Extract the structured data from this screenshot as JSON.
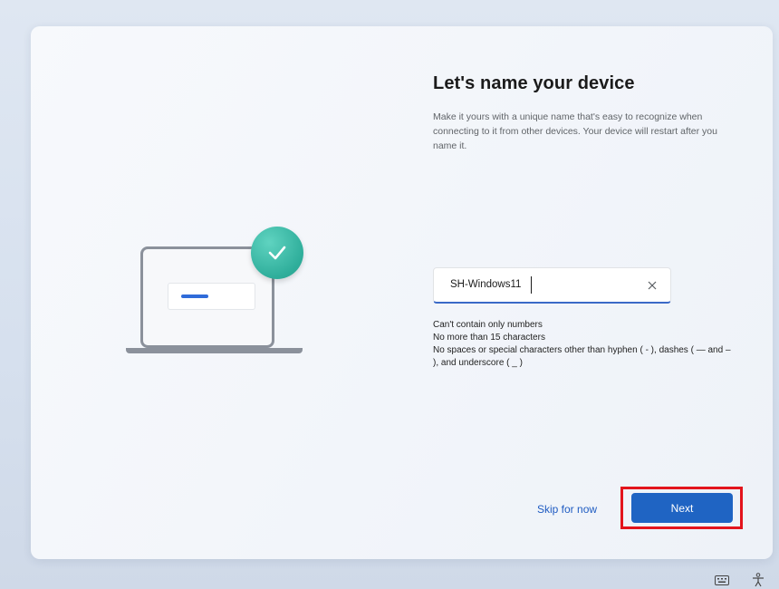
{
  "page": {
    "title": "Let's name your device",
    "description": "Make it yours with a unique name that's easy to recognize when connecting to it from other devices. Your device will restart after you name it."
  },
  "device_name_input": {
    "value": "SH-Windows11",
    "clear_icon": "close-icon"
  },
  "rules": [
    "Can't contain only numbers",
    "No more than 15 characters",
    "No spaces or special characters other than hyphen ( - ), dashes ( — and – ), and underscore ( _ )"
  ],
  "actions": {
    "skip_label": "Skip for now",
    "next_label": "Next"
  },
  "colors": {
    "accent": "#1f64c3",
    "check": "#2fae9b",
    "highlight": "#e3141c"
  },
  "taskbar": {
    "icons": [
      "keyboard-icon",
      "accessibility-icon"
    ]
  }
}
